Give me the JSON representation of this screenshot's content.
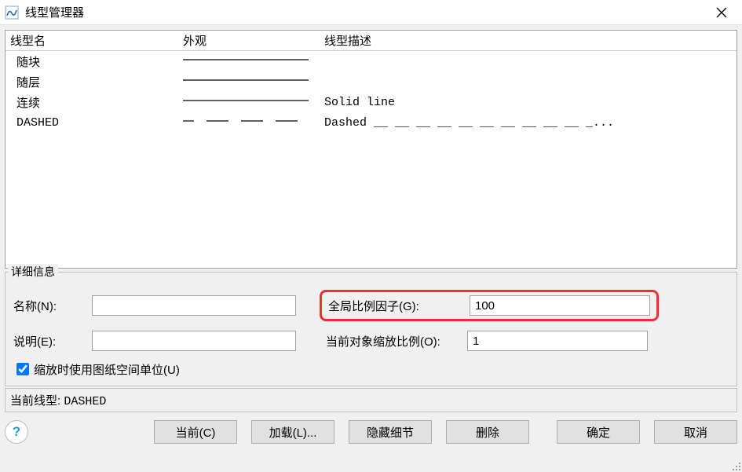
{
  "title": "线型管理器",
  "columns": {
    "name": "线型名",
    "appearance": "外观",
    "desc": "线型描述"
  },
  "rows": [
    {
      "name": "随块",
      "pattern": "solid",
      "desc": ""
    },
    {
      "name": "随层",
      "pattern": "solid",
      "desc": ""
    },
    {
      "name": "连续",
      "pattern": "solid",
      "desc": "Solid line"
    },
    {
      "name": "DASHED",
      "pattern": "dashed",
      "desc": "Dashed __ __ __ __ __ __ __ __ __ __ _..."
    }
  ],
  "details": {
    "legend": "详细信息",
    "name_label": "名称(N):",
    "name_value": "",
    "desc_label": "说明(E):",
    "desc_value": "",
    "global_scale_label": "全局比例因子(G):",
    "global_scale_value": "100",
    "object_scale_label": "当前对象缩放比例(O):",
    "object_scale_value": "1",
    "use_paper_units_label": "缩放时使用图纸空间单位(U)",
    "use_paper_units_checked": true
  },
  "current_linetype": {
    "label": "当前线型:",
    "value": "DASHED"
  },
  "buttons": {
    "help": "?",
    "current": "当前(C)",
    "load": "加载(L)...",
    "hide_details": "隐藏细节",
    "delete": "删除",
    "ok": "确定",
    "cancel": "取消"
  }
}
